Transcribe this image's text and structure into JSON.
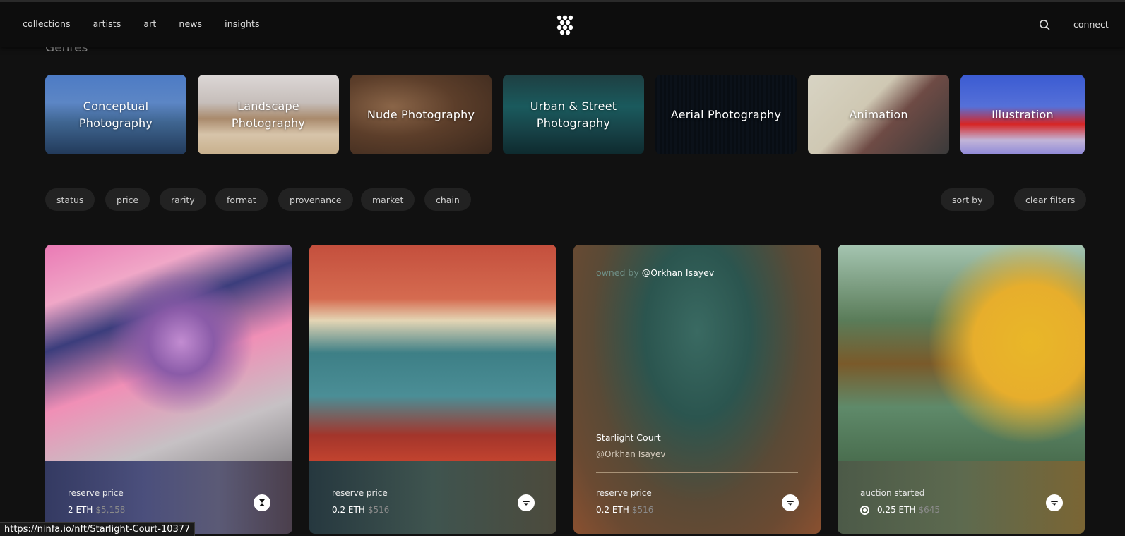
{
  "nav": {
    "items": [
      "collections",
      "artists",
      "art",
      "news",
      "insights"
    ],
    "connect_label": "connect",
    "logo_icon": "ninfa-logo-icon",
    "search_icon": "search-icon"
  },
  "genres": {
    "title": "Genres",
    "items": [
      "Conceptual Photography",
      "Landscape Photography",
      "Nude Photography",
      "Urban & Street Photography",
      "Aerial Photography",
      "Animation",
      "Illustration"
    ]
  },
  "filters": {
    "items": [
      "status",
      "price",
      "rarity",
      "format",
      "provenance",
      "market",
      "chain"
    ],
    "sort_label": "sort by",
    "clear_label": "clear filters"
  },
  "cards": [
    {
      "label": "reserve price",
      "eth": "2 ETH",
      "usd": "$5,158"
    },
    {
      "label": "reserve price",
      "eth": "0.2 ETH",
      "usd": "$516"
    },
    {
      "owned_prefix": "owned by",
      "owner": "@Orkhan Isayev",
      "title": "Starlight Court",
      "artist": "@Orkhan Isayev",
      "label": "reserve price",
      "eth": "0.2 ETH",
      "usd": "$516"
    },
    {
      "label": "auction started",
      "eth": "0.25 ETH",
      "usd": "$645"
    }
  ],
  "status_url": "https://ninfa.io/nft/Starlight-Court-10377"
}
